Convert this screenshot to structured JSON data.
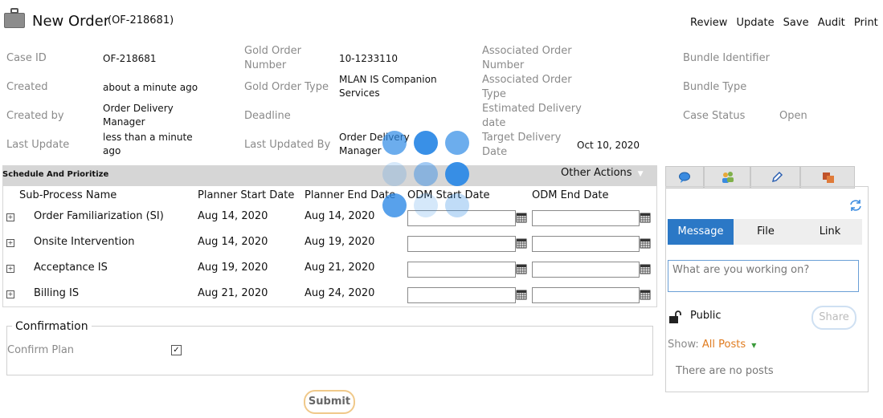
{
  "header": {
    "title": "New Order",
    "case_id_paren": "(OF-218681)",
    "actions": [
      "Review",
      "Update",
      "Save",
      "Audit",
      "Print"
    ]
  },
  "fields": {
    "case_id_label": "Case ID",
    "case_id_value": "OF-218681",
    "created_label": "Created",
    "created_value": "about a minute ago",
    "created_by_label": "Created by",
    "created_by_value_1": "Order Delivery",
    "created_by_value_2": "Manager",
    "last_update_label": "Last Update",
    "last_update_value_1": "less than a minute",
    "last_update_value_2": "ago",
    "gold_order_number_label_1": "Gold Order",
    "gold_order_number_label_2": "Number",
    "gold_order_number_value": "10-1233110",
    "gold_order_type_label": "Gold Order Type",
    "gold_order_type_value_1": "MLAN IS Companion",
    "gold_order_type_value_2": "Services",
    "deadline_label": "Deadline",
    "last_updated_by_label": "Last Updated By",
    "last_updated_by_value_1": "Order Delivery",
    "last_updated_by_value_2": "Manager",
    "assoc_order_number_label_1": "Associated Order",
    "assoc_order_number_label_2": "Number",
    "assoc_order_type_label_1": "Associated Order",
    "assoc_order_type_label_2": "Type",
    "est_delivery_label_1": "Estimated Delivery",
    "est_delivery_label_2": "date",
    "target_delivery_label_1": "Target Delivery",
    "target_delivery_label_2": "Date",
    "target_delivery_value": "Oct 10, 2020",
    "bundle_id_label": "Bundle Identifier",
    "bundle_type_label": "Bundle Type",
    "case_status_label": "Case Status",
    "case_status_value": "Open"
  },
  "schedule": {
    "title": "Schedule And Prioritize",
    "other_actions": "Other Actions",
    "columns": [
      "Sub-Process Name",
      "Planner Start Date",
      "Planner End Date",
      "ODM Start Date",
      "ODM End Date"
    ],
    "rows": [
      {
        "name": "Order Familiarization (SI)",
        "start": "Aug 14, 2020",
        "end": "Aug 14, 2020"
      },
      {
        "name": "Onsite Intervention",
        "start": "Aug 14, 2020",
        "end": "Aug 19, 2020"
      },
      {
        "name": "Acceptance IS",
        "start": "Aug 19, 2020",
        "end": "Aug 21, 2020"
      },
      {
        "name": "Billing IS",
        "start": "Aug 21, 2020",
        "end": "Aug 24, 2020"
      }
    ]
  },
  "confirmation": {
    "legend": "Confirmation",
    "confirm_label": "Confirm Plan",
    "checked": true
  },
  "submit_label": "Submit",
  "pulse": {
    "message_tab": "Message",
    "file_tab": "File",
    "link_tab": "Link",
    "placeholder": "What are you working on?",
    "visibility": "Public",
    "share": "Share",
    "show_label": "Show:",
    "show_value": "All Posts",
    "empty": "There are no posts"
  },
  "colors": {
    "accent": "#2b78c6",
    "orange": "#e07b1e",
    "spinner": "#2e8ae6"
  }
}
